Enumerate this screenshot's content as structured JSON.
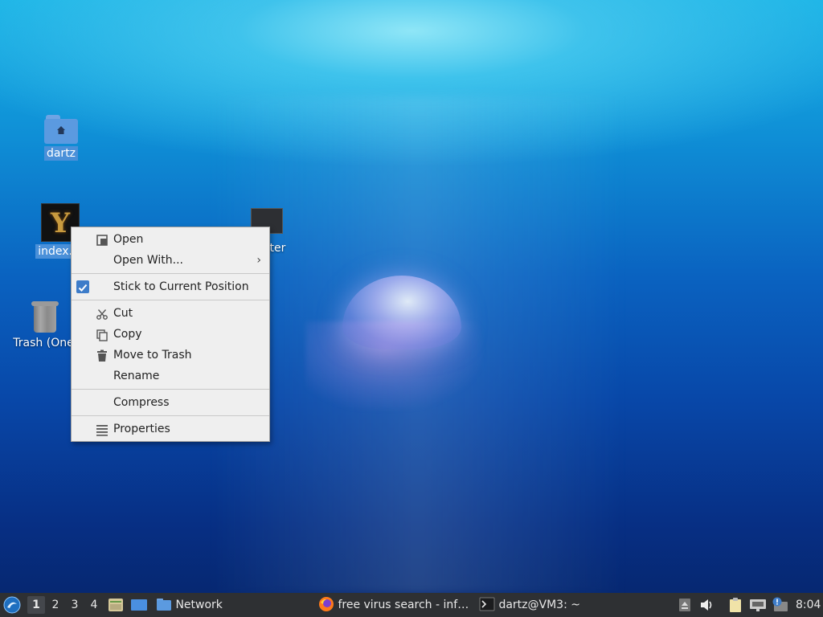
{
  "desktop": {
    "icons": [
      {
        "label": "dartz"
      },
      {
        "label": "index.jp"
      },
      {
        "label": "uter"
      },
      {
        "label": "Trash (One"
      }
    ]
  },
  "context_menu": {
    "items": [
      {
        "label": "Open",
        "icon": "open-icon"
      },
      {
        "label": "Open With...",
        "submenu_arrow": "›"
      },
      {
        "label": "Stick to Current Position",
        "checked": true
      },
      {
        "label": "Cut",
        "icon": "scissors-icon"
      },
      {
        "label": "Copy",
        "icon": "copy-icon"
      },
      {
        "label": "Move to Trash",
        "icon": "trash-icon"
      },
      {
        "label": "Rename"
      },
      {
        "label": "Compress"
      },
      {
        "label": "Properties",
        "icon": "properties-icon"
      }
    ]
  },
  "taskbar": {
    "workspaces": [
      "1",
      "2",
      "3",
      "4"
    ],
    "active_workspace": "1",
    "network_label": "Network",
    "firefox_task": "free virus search - inf…",
    "terminal_task": "dartz@VM3: ~",
    "clock": "8:04"
  },
  "colors": {
    "selection": "#4a90d9",
    "taskbar_bg": "#2e3033",
    "menu_bg": "#efefef",
    "check_accent": "#3d7cc9"
  }
}
